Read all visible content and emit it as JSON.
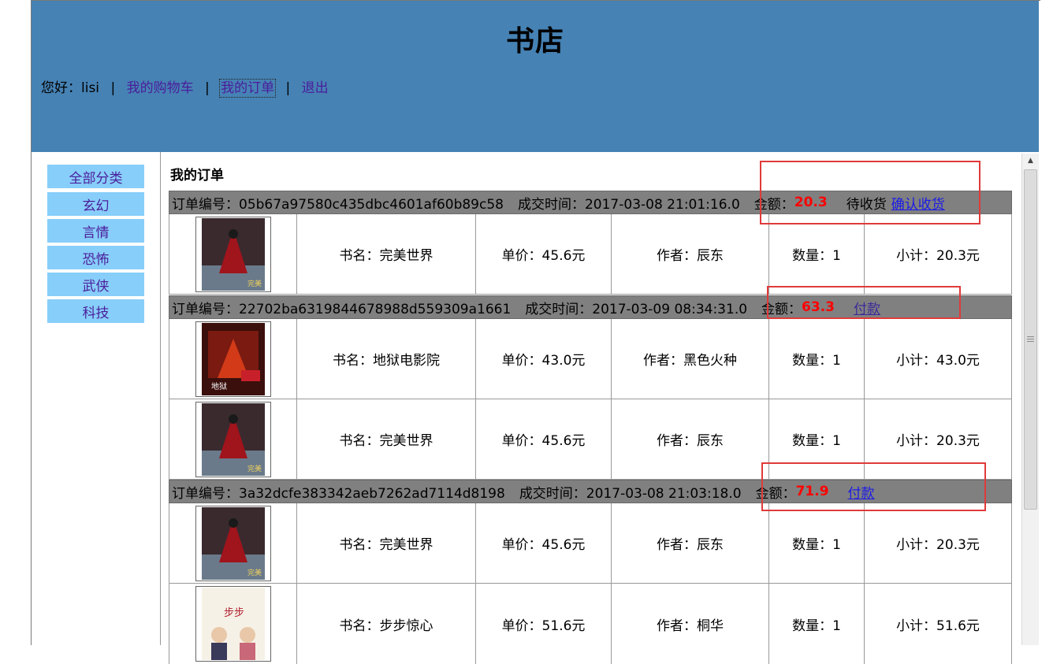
{
  "header": {
    "title": "书店",
    "greeting": "您好：lisi",
    "links": [
      "我的购物车",
      "我的订单",
      "退出"
    ],
    "separator": "|"
  },
  "sidebar": {
    "categories": [
      "全部分类",
      "玄幻",
      "言情",
      "恐怖",
      "武侠",
      "科技"
    ]
  },
  "main": {
    "title": "我的订单",
    "orders": [
      {
        "id_label": "订单编号：05b67a97580c435dbc4601af60b89c58",
        "time_label": "成交时间：2017-03-08 21:01:16.0",
        "amount_label": "金额：",
        "amount": "20.3",
        "status": "待收货",
        "action": "确认收货",
        "items": [
          {
            "name": "书名：完美世界",
            "price": "单价：45.6元",
            "author": "作者：辰东",
            "qty": "数量：1",
            "subtotal": "小计：20.3元",
            "cover": "cover-wanmei"
          }
        ]
      },
      {
        "id_label": "订单编号：22702ba6319844678988d559309a1661",
        "time_label": "成交时间：2017-03-09 08:34:31.0",
        "amount_label": "金额：",
        "amount": "63.3",
        "status": "",
        "action": "付款",
        "items": [
          {
            "name": "书名：地狱电影院",
            "price": "单价：43.0元",
            "author": "作者：黑色火种",
            "qty": "数量：1",
            "subtotal": "小计：43.0元",
            "cover": "cover-diyu"
          },
          {
            "name": "书名：完美世界",
            "price": "单价：45.6元",
            "author": "作者：辰东",
            "qty": "数量：1",
            "subtotal": "小计：20.3元",
            "cover": "cover-wanmei"
          }
        ]
      },
      {
        "id_label": "订单编号：3a32dcfe383342aeb7262ad7114d8198",
        "time_label": "成交时间：2017-03-08 21:03:18.0",
        "amount_label": "金额：",
        "amount": "71.9",
        "status": "",
        "action": "付款",
        "items": [
          {
            "name": "书名：完美世界",
            "price": "单价：45.6元",
            "author": "作者：辰东",
            "qty": "数量：1",
            "subtotal": "小计：20.3元",
            "cover": "cover-wanmei"
          },
          {
            "name": "书名：步步惊心",
            "price": "单价：51.6元",
            "author": "作者：桐华",
            "qty": "数量：1",
            "subtotal": "小计：51.6元",
            "cover": "cover-bubu"
          }
        ]
      }
    ]
  },
  "colors": {
    "header_bg": "#4682b4",
    "category_bg": "#87cefa",
    "order_head_bg": "#808080",
    "amount": "#ff0000",
    "highlight": "#e03a3a"
  }
}
